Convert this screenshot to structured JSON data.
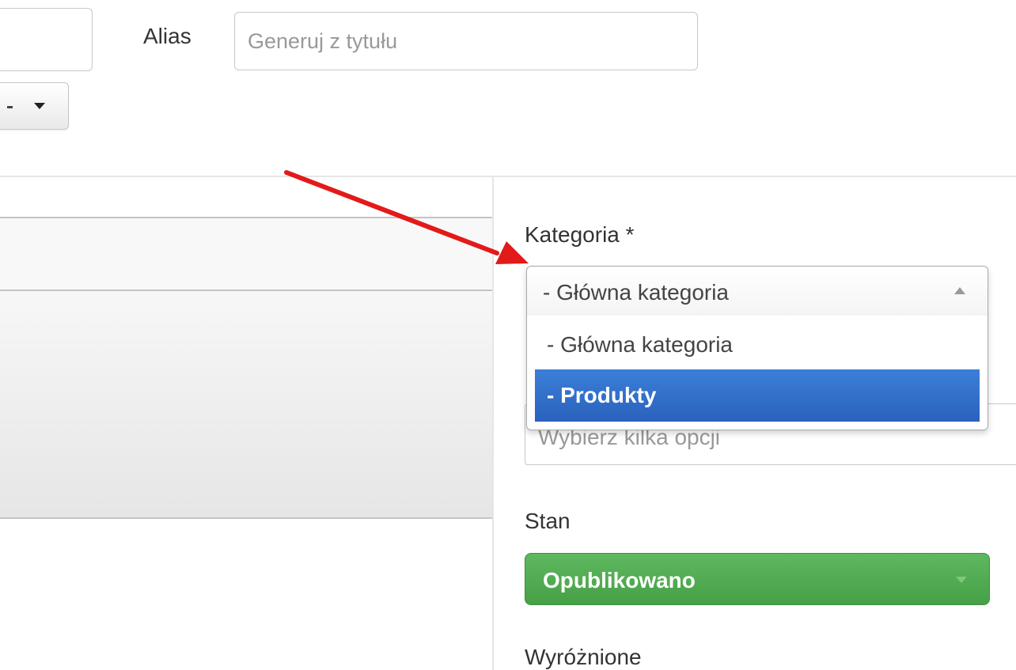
{
  "header": {
    "title_value": "",
    "alias_label": "Alias",
    "alias_placeholder": "Generuj z tytułu"
  },
  "sidebar": {
    "category": {
      "label": "Kategoria *",
      "selected": "- Główna kategoria",
      "options": [
        {
          "label": "- Główna kategoria",
          "highlighted": false
        },
        {
          "label": "- Produkty",
          "highlighted": true
        }
      ]
    },
    "tags": {
      "placeholder": "Wybierz kilka opcji"
    },
    "state": {
      "label": "Stan",
      "selected": "Opublikowano",
      "color": "#4cae4c"
    },
    "featured": {
      "label": "Wyróżnione"
    }
  },
  "annotation": {
    "color": "#e31a1a",
    "icon": "red-arrow-pointer"
  }
}
